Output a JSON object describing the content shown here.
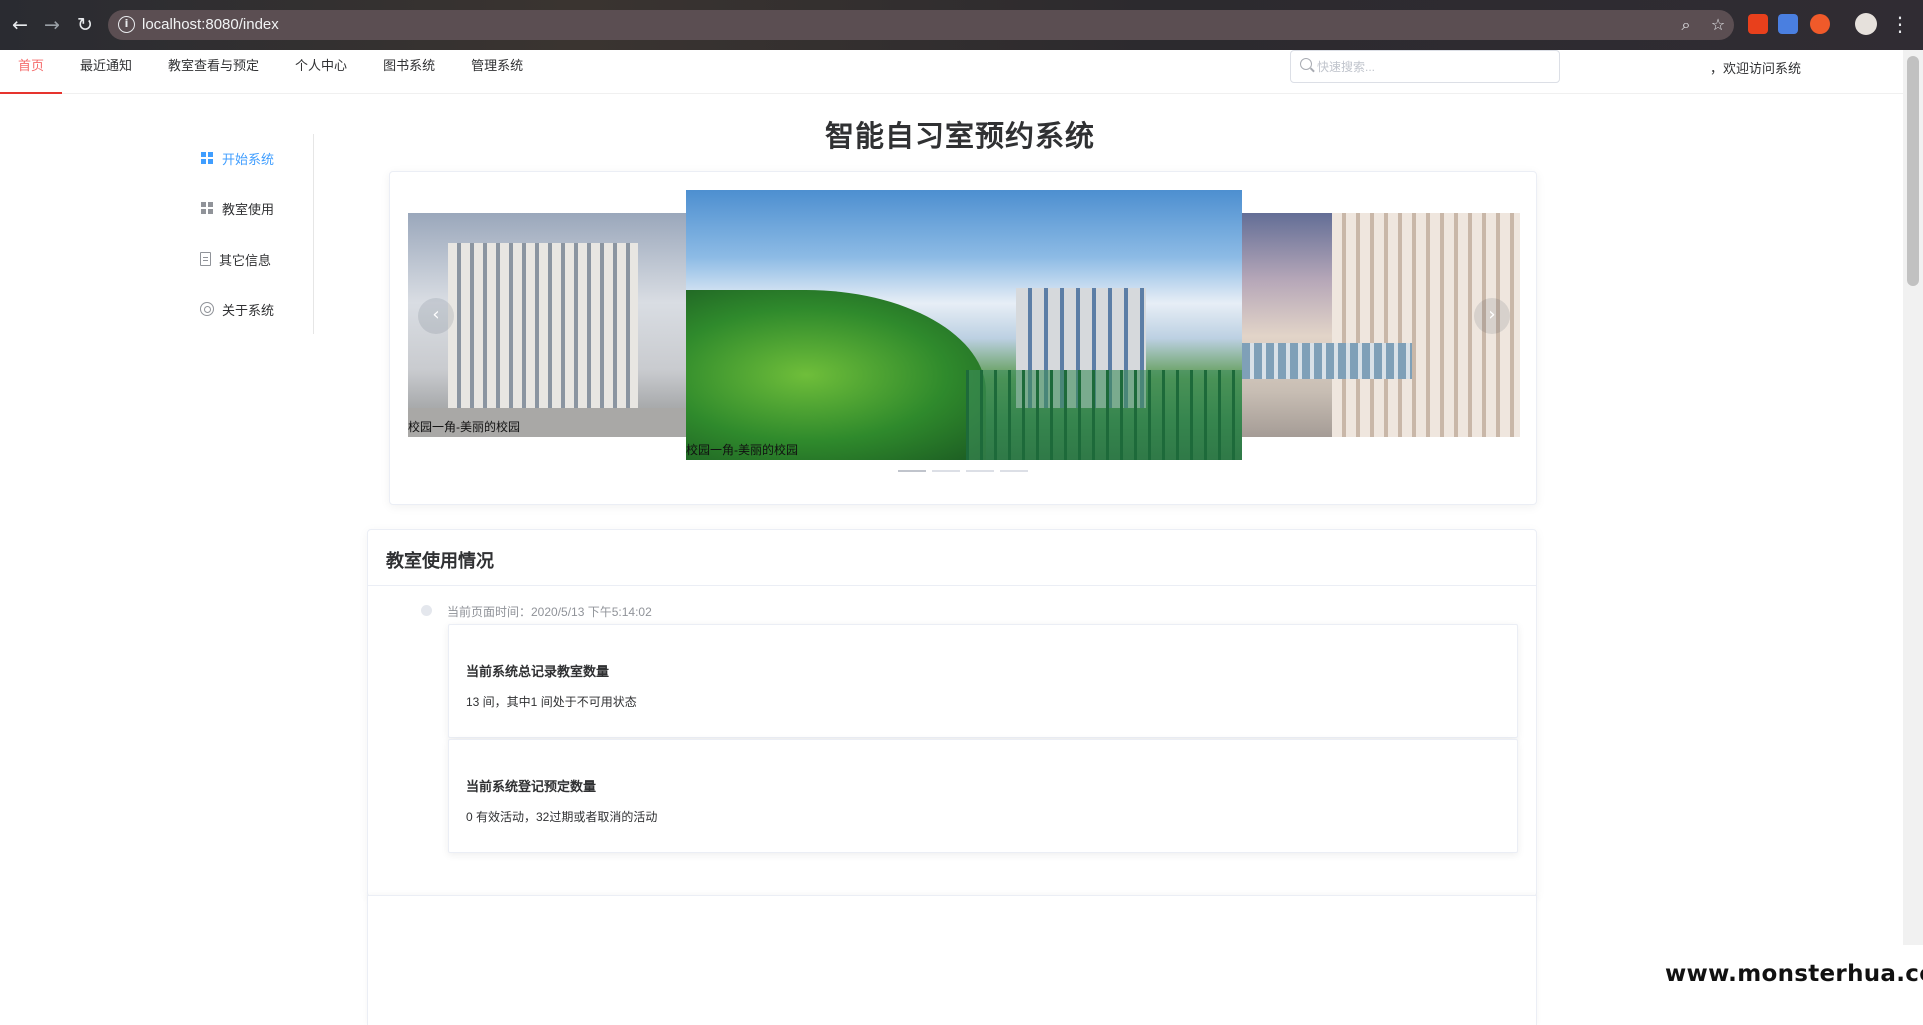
{
  "browser": {
    "url": "localhost:8080/index",
    "back_icon": "arrow-left-icon",
    "forward_icon": "arrow-right-icon",
    "reload_icon": "reload-icon"
  },
  "nav": {
    "tabs": [
      {
        "label": "首页"
      },
      {
        "label": "最近通知"
      },
      {
        "label": "教室查看与预定"
      },
      {
        "label": "个人中心"
      },
      {
        "label": "图书系统"
      },
      {
        "label": "管理系统"
      }
    ],
    "search_placeholder": "快速搜索...",
    "welcome": "，欢迎访问系统"
  },
  "sidebar": {
    "items": [
      {
        "label": "开始系统",
        "icon": "grid-icon"
      },
      {
        "label": "教室使用",
        "icon": "grid-icon"
      },
      {
        "label": "其它信息",
        "icon": "document-icon"
      },
      {
        "label": "关于系统",
        "icon": "gear-icon"
      }
    ]
  },
  "main": {
    "title": "智能自习室预约系统",
    "carousel": {
      "captions": [
        "校园一角-美丽的校园",
        "校园一角-美丽的校园"
      ]
    },
    "usage": {
      "title": "教室使用情况",
      "timestamp": "当前页面时间：2020/5/13 下午5:14:02",
      "stats": [
        {
          "title": "当前系统总记录教室数量",
          "desc": "13 间，其中1 间处于不可用状态"
        },
        {
          "title": "当前系统登记预定数量",
          "desc": "0 有效活动，32过期或者取消的活动"
        }
      ]
    }
  },
  "watermark": "www.monsterhua.com",
  "colors": {
    "accent": "#409eff",
    "active_tab": "#e6342e"
  }
}
